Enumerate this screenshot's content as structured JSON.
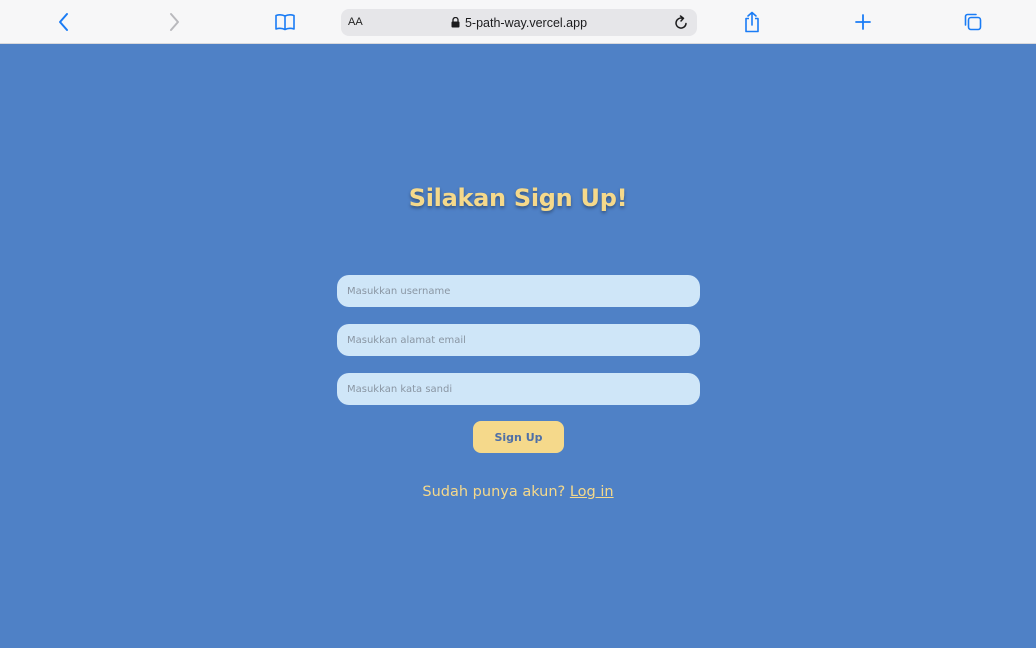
{
  "browser": {
    "text_size_label": "AA",
    "url": "5-path-way.vercel.app",
    "icons": {
      "back": "chevron-left-icon",
      "forward": "chevron-right-icon",
      "bookmarks": "book-icon",
      "lock": "lock-icon",
      "reload": "reload-icon",
      "share": "share-icon",
      "new_tab": "plus-icon",
      "tabs": "tabs-icon"
    },
    "accent_color": "#1a7cf5"
  },
  "page": {
    "background_color": "#4f81c6",
    "accent_color": "#f5d98b",
    "title": "Silakan Sign Up!",
    "form": {
      "username_placeholder": "Masukkan username",
      "email_placeholder": "Masukkan alamat email",
      "password_placeholder": "Masukkan kata sandi",
      "username_value": "",
      "email_value": "",
      "password_value": "",
      "submit_label": "Sign Up"
    },
    "login_prompt": {
      "text": "Sudah punya akun?",
      "link_label": "Log in"
    }
  }
}
